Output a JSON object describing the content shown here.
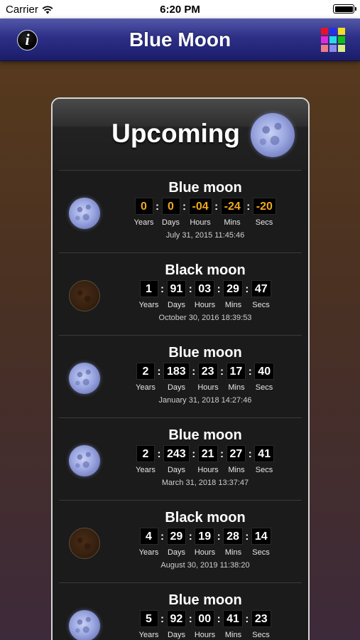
{
  "status": {
    "carrier": "Carrier",
    "time": "6:20 PM"
  },
  "nav": {
    "title": "Blue Moon",
    "info_label": "i"
  },
  "grid_colors": [
    "#e8102a",
    "#2630e8",
    "#f0e020",
    "#e02ad8",
    "#2ad8e8",
    "#10c010",
    "#f07a8a",
    "#8a8ae8",
    "#d8f080"
  ],
  "card": {
    "title": "Upcoming"
  },
  "unit_labels": {
    "years": "Years",
    "days": "Days",
    "hours": "Hours",
    "mins": "Mins",
    "secs": "Secs"
  },
  "events": [
    {
      "name": "Blue moon",
      "type": "blue",
      "years": "0",
      "days": "0",
      "hours": "-04",
      "mins": "-24",
      "secs": "-20",
      "date": "July 31, 2015  11:45:46",
      "past": true
    },
    {
      "name": "Black moon",
      "type": "black",
      "years": "1",
      "days": "91",
      "hours": "03",
      "mins": "29",
      "secs": "47",
      "date": "October 30, 2016  18:39:53",
      "past": false
    },
    {
      "name": "Blue moon",
      "type": "blue",
      "years": "2",
      "days": "183",
      "hours": "23",
      "mins": "17",
      "secs": "40",
      "date": "January 31, 2018  14:27:46",
      "past": false
    },
    {
      "name": "Blue moon",
      "type": "blue",
      "years": "2",
      "days": "243",
      "hours": "21",
      "mins": "27",
      "secs": "41",
      "date": "March 31, 2018  13:37:47",
      "past": false
    },
    {
      "name": "Black moon",
      "type": "black",
      "years": "4",
      "days": "29",
      "hours": "19",
      "mins": "28",
      "secs": "14",
      "date": "August 30, 2019  11:38:20",
      "past": false
    },
    {
      "name": "Blue moon",
      "type": "blue",
      "years": "5",
      "days": "92",
      "hours": "00",
      "mins": "41",
      "secs": "23",
      "date": "",
      "past": false
    }
  ]
}
